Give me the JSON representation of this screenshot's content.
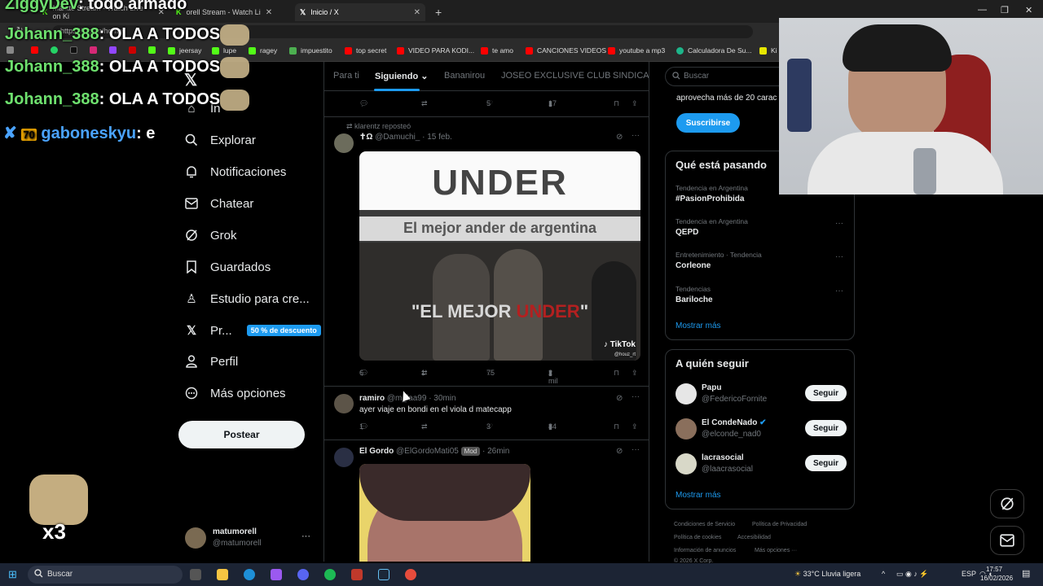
{
  "browser": {
    "tabs": [
      {
        "label": "Mantte Stream - Watch Live on Ki"
      },
      {
        "label": "orell Stream - Watch Li"
      },
      {
        "label": "Inicio / X"
      }
    ],
    "new_tab_symbol": "+",
    "url": "https://x.com/home",
    "bookmarks": [
      "jeersay",
      "lupe",
      "ragey",
      "impuestito",
      "top secret",
      "VIDEO PARA KODI...",
      "te amo",
      "CANCIONES VIDEOS",
      "youtube a mp3",
      "Calculadora De Su...",
      "Ki"
    ]
  },
  "overlay_chat": {
    "line1_user": "ZiggyDev",
    "line1_text": ": todo armado",
    "line2_user": "Johann_388",
    "line2_text": ": OLA A TODOS",
    "line3_user": "Johann_388",
    "line3_text": ": OLA A TODOS",
    "line4_user": "Johann_388",
    "line4_text": ": OLA A TODOS",
    "line5_user": "gaboneskyu",
    "line5_text": ": e",
    "multiplier": "x3"
  },
  "nav": {
    "items": [
      {
        "label": "In",
        "icon": "home-icon"
      },
      {
        "label": "Explorar",
        "icon": "search-icon"
      },
      {
        "label": "Notificaciones",
        "icon": "bell-icon"
      },
      {
        "label": "Chatear",
        "icon": "mail-icon"
      },
      {
        "label": "Grok",
        "icon": "grok-icon"
      },
      {
        "label": "Guardados",
        "icon": "bookmark-icon"
      },
      {
        "label": "Estudio para cre...",
        "icon": "creator-studio-icon"
      },
      {
        "label": "Pr...",
        "icon": "x-logo-icon"
      },
      {
        "label": "Perfil",
        "icon": "person-icon"
      },
      {
        "label": "Más opciones",
        "icon": "more-icon"
      }
    ],
    "premium_badge": "50 % de descuento",
    "post_label": "Postear",
    "account_name": "matumorell",
    "account_handle": "@matumorell",
    "account_more": "···"
  },
  "feed": {
    "tabs": [
      "Para ti",
      "Siguiendo",
      "Bananirou",
      "JOSEO EXCLUSIVE CLUB",
      "SINDICAT"
    ],
    "active_tab": "Siguiendo",
    "top_actions": {
      "replies": "",
      "reposts": "",
      "likes": "5",
      "views": "17"
    },
    "tweet1": {
      "repost_note": "klarentz reposteó",
      "name": "✝Ω",
      "handle": "@Damuchi_",
      "time": "· 15 feb.",
      "media_title": "UNDER",
      "media_subtitle": "El mejor ander de argentina",
      "media_caption_a": "\"EL MEJOR ",
      "media_caption_b": "UNDER",
      "media_caption_c": "\"",
      "media_brand": "TikTok",
      "media_handle": "@houz_rt",
      "replies": "6",
      "reposts": "1",
      "likes": "75",
      "views": "2 mil"
    },
    "tweet2": {
      "name": "ramiro",
      "handle": "@m_laa99",
      "time": "· 30min",
      "text": "ayer viaje en bondi en el viola d matecapp",
      "replies": "1",
      "reposts": "",
      "likes": "3",
      "views": "84"
    },
    "tweet3": {
      "name": "El Gordo",
      "handle": "@ElGordoMati05",
      "badge": "Mod",
      "time": "· 26min"
    }
  },
  "right": {
    "search_placeholder": "Buscar",
    "premium_text": "aprovecha más de 20 carac",
    "subscribe_label": "Suscribirse",
    "trends_title": "Qué está pasando",
    "trends": [
      {
        "meta": "Tendencia en Argentina",
        "name": "#PasionProhibida"
      },
      {
        "meta": "Tendencia en Argentina",
        "name": "QEPD"
      },
      {
        "meta": "Entretenimiento · Tendencia",
        "name": "Corleone"
      },
      {
        "meta": "Tendencias",
        "name": "Bariloche"
      }
    ],
    "show_more": "Mostrar más",
    "who_title": "A quién seguir",
    "who": [
      {
        "name": "Papu",
        "handle": "@FedericoFornite"
      },
      {
        "name": "El CondeNado",
        "handle": "@elconde_nad0"
      },
      {
        "name": "lacrasocial",
        "handle": "@laacrasocial"
      }
    ],
    "follow_label": "Seguir",
    "footer_links": [
      "Condiciones de Servicio",
      "Política de Privacidad",
      "Política de cookies",
      "Accesibilidad",
      "Información de anuncios",
      "Más opciones ···"
    ],
    "copyright": "© 2026 X Corp."
  },
  "taskbar": {
    "search_label": "Buscar",
    "weather": "33°C  Lluvia ligera",
    "lang": "ESP",
    "time": "17:57",
    "date": "16/02/2026"
  },
  "colors": {
    "accent": "#1d9bf0",
    "bg": "#000000",
    "border": "#2f3336",
    "muted": "#71767b",
    "text": "#e7e9ea"
  }
}
